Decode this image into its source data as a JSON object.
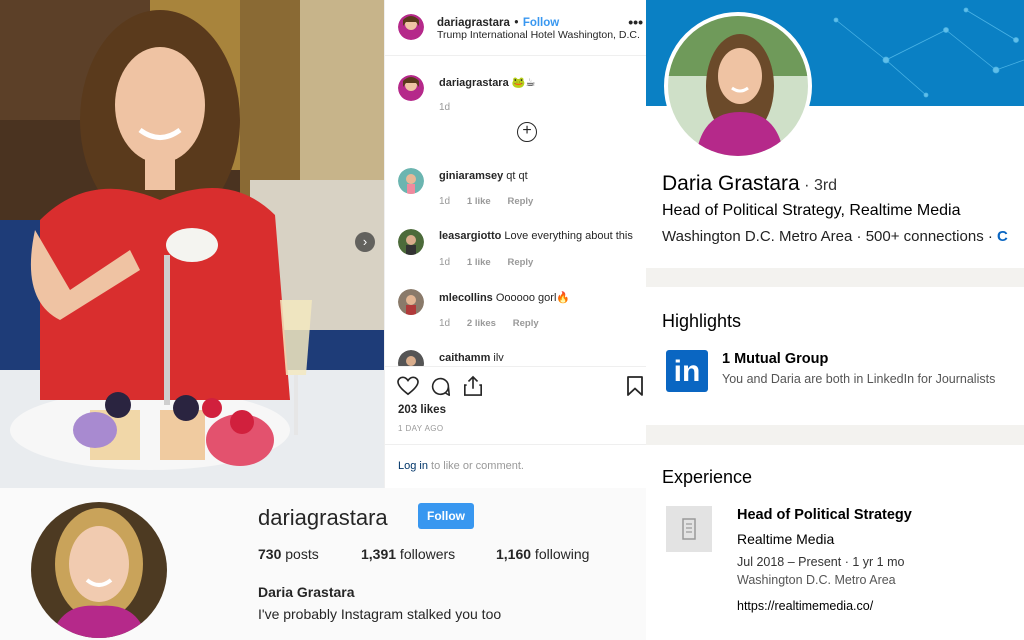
{
  "post": {
    "username": "dariagrastara",
    "separator": "•",
    "follow": "Follow",
    "location": "Trump International Hotel Washington, D.C.",
    "more": "•••",
    "caption": {
      "username": "dariagrastara",
      "text": "🐸☕",
      "time": "1d"
    },
    "comments": [
      {
        "username": "giniaramsey",
        "text": "qt qt",
        "time": "1d",
        "likes": "1 like",
        "reply": "Reply"
      },
      {
        "username": "leasargiotto",
        "text": "Love everything about this",
        "time": "1d",
        "likes": "1 like",
        "reply": "Reply"
      },
      {
        "username": "mlecollins",
        "text": "Oooooo gorl🔥",
        "time": "1d",
        "likes": "2 likes",
        "reply": "Reply"
      },
      {
        "username": "caithamm",
        "text": "ilv"
      }
    ],
    "likes": "203 likes",
    "posted_ago": "1 DAY AGO",
    "login_link": "Log in",
    "login_rest": " to like or comment.",
    "icons": [
      "heart-icon",
      "comment-icon",
      "share-icon",
      "bookmark-icon",
      "add-circle-icon",
      "chevron-right-icon"
    ]
  },
  "profile": {
    "username": "dariagrastara",
    "follow": "Follow",
    "posts_num": "730",
    "posts_label": " posts",
    "followers_num": "1,391",
    "followers_label": " followers",
    "following_num": "1,160",
    "following_label": " following",
    "name": "Daria Grastara",
    "bio": "I've probably Instagram stalked you too"
  },
  "linkedin": {
    "name": "Daria Grastara",
    "degree": " · 3rd",
    "headline": "Head of Political Strategy, Realtime Media",
    "location": "Washington D.C. Metro Area",
    "connections": " · 500+ connections · ",
    "contact_initial": "C",
    "highlights_title": "Highlights",
    "mutual_title": "1 Mutual Group",
    "mutual_desc": "You and Daria are both in LinkedIn for Journalists",
    "logo_text": "in",
    "experience_title": "Experience",
    "job_title": "Head of Political Strategy",
    "company": "Realtime Media",
    "dates": "Jul 2018 – Present · 1 yr 1 mo",
    "job_location": "Washington D.C. Metro Area",
    "url": "https://realtimemedia.co/"
  },
  "colors": {
    "instagram_blue": "#3897f0",
    "linkedin_blue": "#0a66c2",
    "banner": "#0a80c4",
    "dress": "#d92e2e",
    "top": "#b5298a"
  }
}
